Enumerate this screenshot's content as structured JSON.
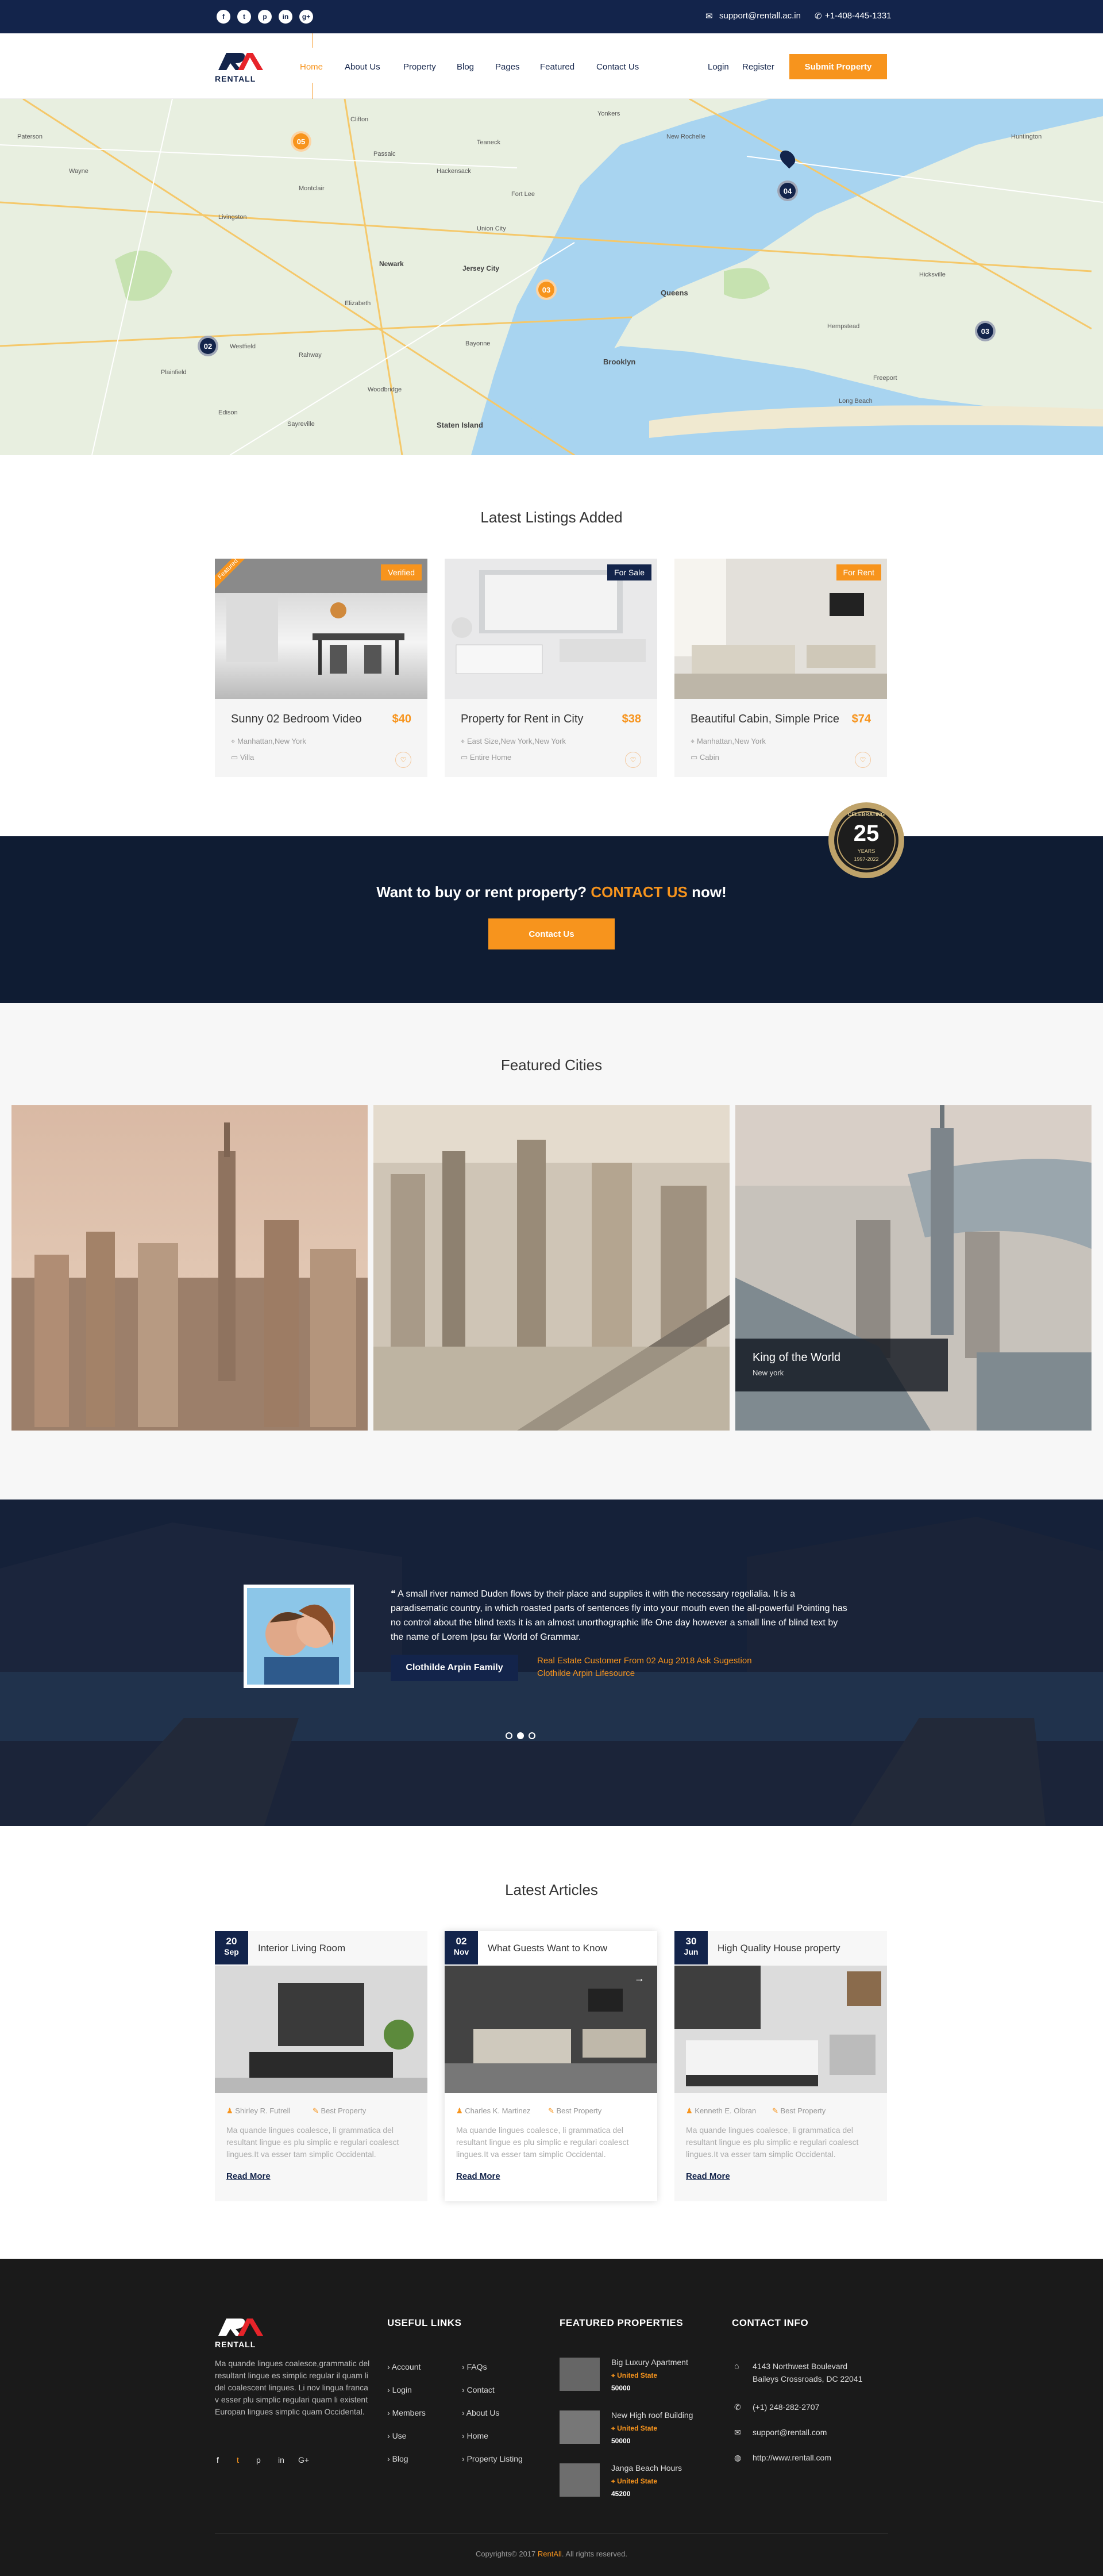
{
  "topbar": {
    "social": [
      "f",
      "t",
      "p",
      "in",
      "g+"
    ],
    "email": "support@rentall.ac.in",
    "phone": "+1-408-445-1331"
  },
  "header": {
    "logo_mark": "RA",
    "logo_text": "RENTALL",
    "nav": [
      "Home",
      "About Us",
      "Property",
      "Blog",
      "Pages",
      "Featured",
      "Contact Us"
    ],
    "login": "Login",
    "register": "Register",
    "submit": "Submit Property"
  },
  "map": {
    "pins": [
      "05",
      "04",
      "03",
      "02",
      "03"
    ],
    "places": [
      "Paterson",
      "Clifton",
      "Wayne",
      "Passaic",
      "Montclair",
      "Livingston",
      "Newark",
      "Jersey City",
      "Union City",
      "Elizabeth",
      "Bayonne",
      "Plainfield",
      "Westfield",
      "Rahway",
      "Staten Island",
      "Brooklyn",
      "Queens",
      "New Rochelle",
      "Yonkers",
      "Long Beach",
      "Hempstead",
      "Hicksville",
      "Huntington",
      "Freeport",
      "Fort Lee",
      "Hackensack",
      "Teaneck",
      "Sayreville",
      "Woodbridge",
      "Edison"
    ]
  },
  "listings": {
    "title": "Latest Listings Added",
    "items": [
      {
        "tag": "Verified",
        "ribbon": "Featured",
        "title": "Sunny 02 Bedroom Video",
        "price": "$40",
        "location": "Manhattan,New York",
        "type": "Villa",
        "tag_color": "#f7941d"
      },
      {
        "tag": "For Sale",
        "ribbon": "",
        "title": "Property for Rent in City",
        "price": "$38",
        "location": "East Size,New York,New York",
        "type": "Entire Home",
        "tag_color": "#13244b"
      },
      {
        "tag": "For Rent",
        "ribbon": "",
        "title": "Beautiful Cabin, Simple Price",
        "price": "$74",
        "location": "Manhattan,New York",
        "type": "Cabin",
        "tag_color": "#f7941d"
      }
    ]
  },
  "cta": {
    "text_before": "Want to buy or rent property?",
    "highlight": "CONTACT US",
    "text_after": "now!",
    "button": "Contact Us",
    "badge_top": "CELEBRATING",
    "badge_num": "25",
    "badge_sub": "YEARS",
    "badge_years": "1997-2022"
  },
  "cities": {
    "title": "Featured Cities",
    "overlay_title": "King of the World",
    "overlay_sub": "New york"
  },
  "testimonial": {
    "quote": "A small river named Duden flows by their place and supplies it with the necessary regelialia. It is a paradisematic country, in which roasted parts of sentences fly into your mouth even the all-powerful Pointing has no control about the blind texts it is an almost unorthographic life One day however a small line of blind text by the name of Lorem Ipsu far World of Grammar.",
    "name": "Clothilde Arpin  Family",
    "role_line1": "Real Estate Customer From 02 Aug 2018 Ask Sugestion",
    "role_line2": "Clothilde Arpin Lifesource",
    "dots": 3
  },
  "articles": {
    "title": "Latest Articles",
    "items": [
      {
        "day": "20",
        "month": "Sep",
        "title": "Interior Living Room",
        "author": "Shirley R. Futrell",
        "category": "Best Property",
        "text": "Ma quande lingues coalesce, li grammatica del resultant lingue es plu simplic e regulari coalesct lingues.It va esser tam simplic Occidental.",
        "more": "Read More"
      },
      {
        "day": "02",
        "month": "Nov",
        "title": "What Guests Want to Know",
        "author": "Charles K. Martinez",
        "category": "Best Property",
        "text": "Ma quande lingues coalesce, li grammatica del resultant lingue es plu simplic e regulari coalesct lingues.It va esser tam simplic Occidental.",
        "more": "Read More"
      },
      {
        "day": "30",
        "month": "Jun",
        "title": "High Quality House property",
        "author": "Kenneth E. Olbran",
        "category": "Best Property",
        "text": "Ma quande lingues coalesce, li grammatica del resultant lingue es plu simplic e regulari coalesct lingues.It va esser tam simplic Occidental.",
        "more": "Read More"
      }
    ]
  },
  "footer": {
    "about": "Ma quande lingues coalesce,grammatic del resultant lingue es simplic regular il quam li del coalescent lingues. Li nov lingua franca v esser plu simplic regulari quam li existent Europan lingues simplic quam Occidental.",
    "social": [
      "f",
      "t",
      "p",
      "in",
      "G+"
    ],
    "links_title": "USEFUL LINKS",
    "links_col1": [
      "Account",
      "Login",
      "Members",
      "Use",
      "Blog"
    ],
    "links_col2": [
      "FAQs",
      "Contact",
      "About Us",
      "Home",
      "Property Listing"
    ],
    "featured_title": "FEATURED PROPERTIES",
    "featured": [
      {
        "name": "Big Luxury Apartment",
        "country": "United State",
        "price": "50000"
      },
      {
        "name": "New High roof Building",
        "country": "United State",
        "price": "50000"
      },
      {
        "name": "Janga Beach Hours",
        "country": "United State",
        "price": "45200"
      }
    ],
    "contact_title": "CONTACT INFO",
    "address1": "4143 Northwest Boulevard",
    "address2": "Baileys Crossroads, DC 22041",
    "phone": "(+1) 248-282-2707",
    "email": "support@rentall.com",
    "web": "http://www.rentall.com",
    "copy_before": "Copyrights© 2017",
    "copy_brand": "RentAll",
    "copy_after": ". All rights reserved."
  }
}
